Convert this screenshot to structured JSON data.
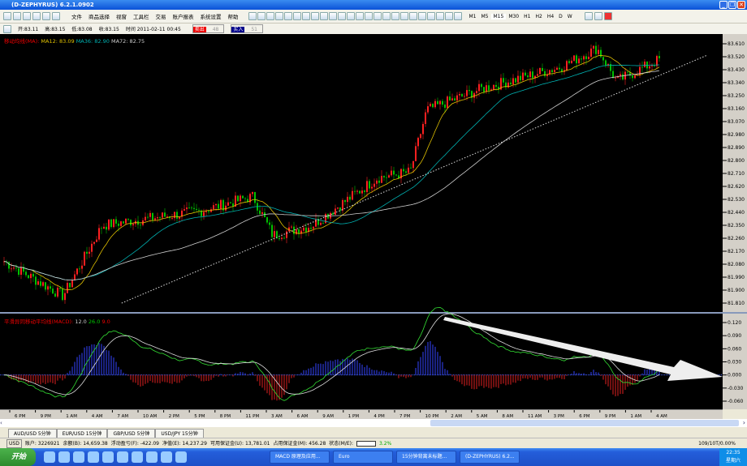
{
  "window": {
    "title": "(D-ZEPHYRUS) 6.2.1.0902"
  },
  "menu": [
    "文件",
    "商品选择",
    "视窗",
    "工具栏",
    "交易",
    "账户报表",
    "系统设置",
    "帮助"
  ],
  "timeframes": [
    "M1",
    "M5",
    "M15",
    "M30",
    "H1",
    "H2",
    "H4",
    "D",
    "W"
  ],
  "active_timeframe": "M15",
  "info": {
    "open": "开:83.11",
    "high": "高:83.15",
    "low": "低:83.08",
    "close": "收:83.15",
    "time": "时间 2011-02-11 00:45",
    "sell": "卖出",
    "sell_val": "48",
    "buy": "买入",
    "buy_val": "51"
  },
  "ma_legend": {
    "label": "移动均线(MA):",
    "ma12": "MA12: 83.09",
    "ma36": "MA36: 82.90",
    "ma72": "MA72: 82.75"
  },
  "macd_legend": {
    "label": "平滑异同移动平均线(MACD):",
    "p1": "12.0",
    "p2": "26.0",
    "p3": "9.0"
  },
  "colors": {
    "up": "#ff2020",
    "down": "#00c000",
    "ma12": "#e0c000",
    "ma36": "#00b0b0",
    "ma72": "#d0d0d0"
  },
  "chart_data": {
    "type": "candlestick",
    "y_ticks": [
      "83.610",
      "83.520",
      "83.430",
      "83.340",
      "83.250",
      "83.160",
      "83.070",
      "82.980",
      "82.890",
      "82.800",
      "82.710",
      "82.620",
      "82.530",
      "82.440",
      "82.350",
      "82.260",
      "82.170",
      "82.080",
      "81.990",
      "81.900",
      "81.810"
    ],
    "ylim": [
      81.81,
      83.61
    ],
    "macd_ticks": [
      "0.120",
      "0.090",
      "0.060",
      "0.030",
      "0.000",
      "-0.030",
      "-0.060"
    ],
    "macd_ylim": [
      -0.06,
      0.12
    ],
    "x_ticks": [
      "6 PM",
      "9 PM",
      "1 AM",
      "4 AM",
      "7 AM",
      "10 AM",
      "2 PM",
      "5 PM",
      "8 PM",
      "11 PM",
      "3 AM",
      "6 AM",
      "9 AM",
      "1 PM",
      "4 PM",
      "7 PM",
      "10 PM",
      "2 AM",
      "5 AM",
      "8 AM",
      "11 AM",
      "3 PM",
      "6 PM",
      "9 PM",
      "1 AM",
      "4 AM"
    ],
    "price_path": [
      [
        0,
        82.1
      ],
      [
        0.09,
        81.86
      ],
      [
        0.15,
        82.35
      ],
      [
        0.3,
        82.45
      ],
      [
        0.38,
        82.55
      ],
      [
        0.41,
        82.28
      ],
      [
        0.47,
        82.35
      ],
      [
        0.57,
        82.68
      ],
      [
        0.62,
        82.72
      ],
      [
        0.645,
        83.15
      ],
      [
        0.73,
        83.3
      ],
      [
        0.85,
        83.45
      ],
      [
        0.905,
        83.58
      ],
      [
        0.935,
        83.35
      ],
      [
        1,
        83.5
      ]
    ],
    "trendline": [
      [
        0.18,
        81.81
      ],
      [
        1.07,
        83.53
      ]
    ]
  },
  "tabs": [
    "AUD/USD 5分钟",
    "EUR/USD 15分钟",
    "GBP/USD 5分钟",
    "USD/JPY 15分钟"
  ],
  "status": {
    "currency": "USD",
    "account": "账户: 3226921",
    "balance": "余额(B): 14,659.38",
    "float": "浮动盈亏(F): -422.09",
    "equity": "净值(E): 14,237.29",
    "free": "可用保证金(U): 13,781.01",
    "used": "占用保证金(M): 456.28",
    "state": "状态(M/E):",
    "pct": "3.2%",
    "right": "109/10T/0.00%"
  },
  "taskbar": {
    "start": "开始",
    "tasks": [
      "MACD 原理及应用...",
      "Euro",
      "15分钟背离未标题...",
      "(D-ZEPHYRUS) 6.2..."
    ],
    "clock": "22:35",
    "day": "星期六"
  }
}
